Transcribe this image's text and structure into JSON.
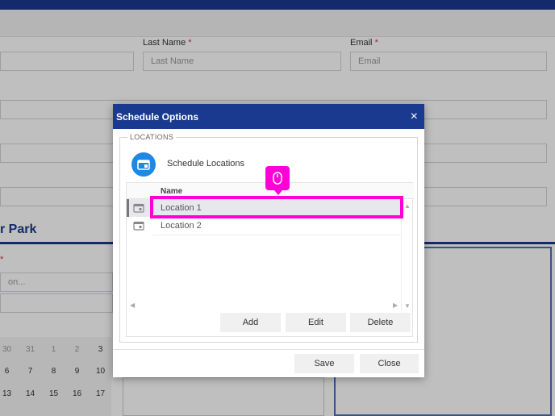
{
  "background": {
    "form": {
      "last_name_label": "Last Name",
      "last_name_placeholder": "Last Name",
      "email_label": "Email",
      "email_placeholder": "Email",
      "required_mark": "*",
      "cut_placeholder": "on...",
      "section_title": "r Park"
    },
    "calendar_rows": [
      [
        "30",
        "31",
        "1",
        "2",
        "3"
      ],
      [
        "6",
        "7",
        "8",
        "9",
        "10"
      ],
      [
        "13",
        "14",
        "15",
        "16",
        "17"
      ]
    ]
  },
  "dialog": {
    "title": "Schedule Options",
    "close_icon": "×",
    "legend": "LOCATIONS",
    "section_title": "Schedule Locations",
    "grid": {
      "column_header": "Name",
      "rows": [
        {
          "label": "Location 1",
          "selected": true
        },
        {
          "label": "Location 2",
          "selected": false
        }
      ]
    },
    "buttons": {
      "add": "Add",
      "edit": "Edit",
      "delete": "Delete"
    },
    "footer": {
      "save": "Save",
      "close": "Close"
    }
  },
  "colors": {
    "brand": "#1a3a8f",
    "highlight": "#ff00d6",
    "icon_blue": "#1e88e5"
  },
  "icons": {
    "location_section": "calendar-location-icon",
    "row": "calendar-icon",
    "pointer": "mouse-icon"
  }
}
